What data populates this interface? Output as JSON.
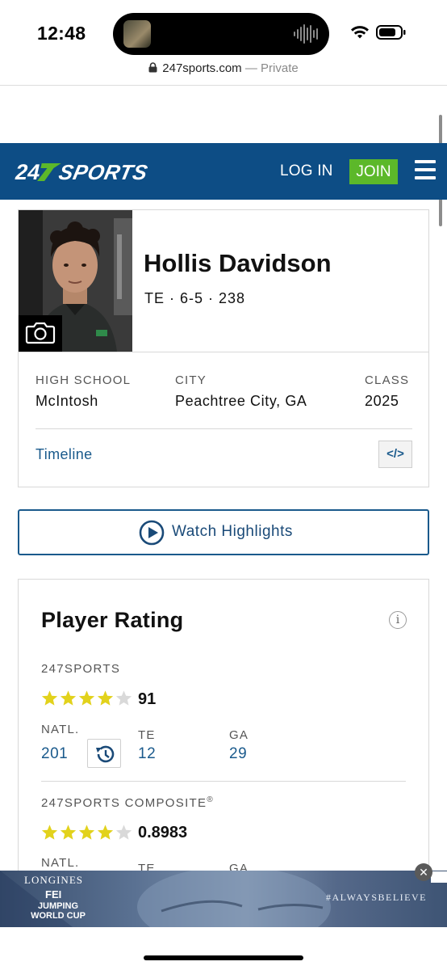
{
  "status_bar": {
    "time": "12:48"
  },
  "browser": {
    "domain": "247sports.com",
    "separator": " — ",
    "mode": "Private"
  },
  "header": {
    "logo_text": "247SPORTS",
    "login_label": "LOG IN",
    "join_label": "JOIN",
    "colors": {
      "header_bg": "#0d4d85",
      "join_bg": "#5cb82a"
    }
  },
  "player": {
    "name": "Hollis Davidson",
    "position": "TE",
    "height": "6-5",
    "weight": "238",
    "meta": "TE · 6-5 · 238",
    "info": {
      "high_school_label": "HIGH SCHOOL",
      "high_school": "McIntosh",
      "city_label": "CITY",
      "city": "Peachtree City, GA",
      "class_label": "CLASS",
      "class": "2025"
    },
    "timeline_label": "Timeline",
    "embed_label": "</>"
  },
  "highlights": {
    "label": "Watch Highlights"
  },
  "rating": {
    "title": "Player Rating",
    "info_glyph": "i",
    "sports247": {
      "label": "247SPORTS",
      "stars": 4,
      "max_stars": 5,
      "value": "91",
      "natl_label": "NATL.",
      "natl": "201",
      "pos_label": "TE",
      "pos": "12",
      "state_label": "GA",
      "state": "29"
    },
    "composite": {
      "label": "247SPORTS COMPOSITE",
      "mark": "®",
      "stars": 4,
      "max_stars": 5,
      "value": "0.8983",
      "natl_label": "NATL.",
      "pos_label": "TE",
      "state_label": "GA"
    },
    "star_color": "#e2d21c"
  },
  "ad": {
    "brand": "LONGINES",
    "fei": "FEI",
    "event": "JUMPING WORLD CUP",
    "slogan": "#ALWAYSBELIEVE",
    "close_glyph": "✕"
  }
}
